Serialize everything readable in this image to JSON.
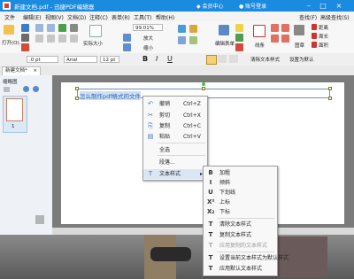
{
  "window": {
    "title": "新建文档.pdf - 迅捷PDF编辑器",
    "vip_label": "会员中心",
    "account_label": "账号登录"
  },
  "menubar": {
    "items": [
      "文件",
      "编辑(E)",
      "视图(V)",
      "文档(D)",
      "注释(C)",
      "表单(R)",
      "工具(T)",
      "帮助(H)"
    ],
    "right_items": [
      "查找(F)",
      "高级查找(S)"
    ]
  },
  "ribbon": {
    "open_label": "打开(O)...",
    "actual_size_label": "实际大小",
    "zoom_value": "99.01%",
    "zoom_in_label": "放大",
    "zoom_out_label": "缩小",
    "edit_form_label": "编辑表单",
    "line_label": "线条",
    "stamp_label": "图章",
    "distance_label": "距离",
    "perimeter_label": "周长",
    "area_label": "面积"
  },
  "formatbar": {
    "font_size_value": ".0 pt",
    "font_name_value": "Arial",
    "font_pt_value": "12 pt",
    "clear_style_label": "清除文本样式",
    "set_default_label": "设置为默认",
    "bold_label": "B",
    "italic_label": "I",
    "underline_label": "U"
  },
  "tabs": [
    {
      "label": "新建文档*",
      "close": "×"
    }
  ],
  "thumbnails": {
    "title": "缩略图",
    "pages": [
      {
        "number": "1"
      }
    ]
  },
  "document": {
    "selected_text": "怎么制作pdf格式的文件"
  },
  "context_menu": [
    {
      "icon": "undo-icon",
      "glyph": "↶",
      "label": "撤销",
      "shortcut": "Ctrl+Z",
      "enabled": true
    },
    {
      "icon": "cut-icon",
      "glyph": "✂",
      "label": "剪切",
      "shortcut": "Ctrl+X",
      "enabled": true
    },
    {
      "icon": "copy-icon",
      "glyph": "⎘",
      "label": "复制",
      "shortcut": "Ctrl+C",
      "enabled": true
    },
    {
      "icon": "paste-icon",
      "glyph": "▤",
      "label": "粘贴",
      "shortcut": "Ctrl+V",
      "enabled": true
    },
    {
      "icon": "",
      "glyph": "",
      "label": "全选",
      "shortcut": "",
      "enabled": true
    },
    {
      "icon": "",
      "glyph": "",
      "label": "段落...",
      "shortcut": "",
      "enabled": true
    },
    {
      "icon": "text-style-icon",
      "glyph": "T",
      "label": "文本样式",
      "shortcut": "",
      "enabled": true,
      "submenu": true
    }
  ],
  "submenu": [
    {
      "icon": "bold-icon",
      "glyph": "B",
      "label": "加粗",
      "enabled": true
    },
    {
      "icon": "italic-icon",
      "glyph": "I",
      "label": "倾斜",
      "enabled": true
    },
    {
      "icon": "underline-icon",
      "glyph": "U",
      "label": "下划线",
      "enabled": true
    },
    {
      "icon": "superscript-icon",
      "glyph": "X²",
      "label": "上标",
      "enabled": true
    },
    {
      "icon": "subscript-icon",
      "glyph": "X₂",
      "label": "下标",
      "enabled": true
    },
    {
      "icon": "clear-style-icon",
      "glyph": "T",
      "label": "清除文本样式",
      "enabled": true
    },
    {
      "icon": "copy-style-icon",
      "glyph": "T",
      "label": "复制文本样式",
      "enabled": true
    },
    {
      "icon": "apply-style-icon",
      "glyph": "T",
      "label": "应用复制的文本样式",
      "enabled": false
    },
    {
      "icon": "set-default-icon",
      "glyph": "T",
      "label": "设置当前文本样式为默认样式",
      "enabled": true
    },
    {
      "icon": "apply-default-icon",
      "glyph": "T",
      "label": "应用默认文本样式",
      "enabled": true
    }
  ],
  "colors": {
    "titlebar": "#1b8be0",
    "accent": "#2f63b5"
  }
}
